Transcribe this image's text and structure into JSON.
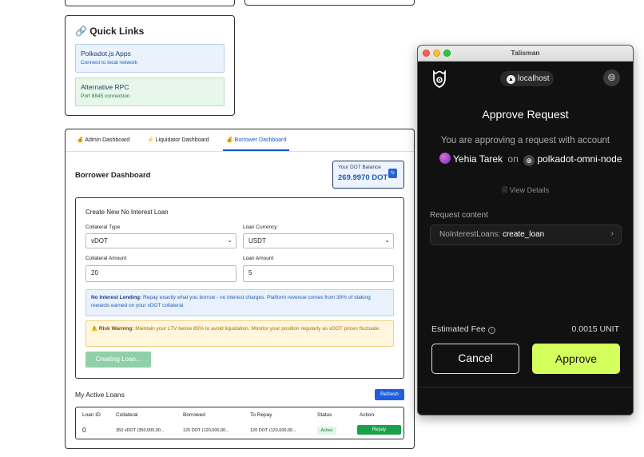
{
  "quick_links": {
    "title": "Quick Links",
    "items": [
      {
        "title": "Polkadot.js Apps",
        "subtitle": "Connect to local network"
      },
      {
        "title": "Alternative RPC",
        "subtitle": "Port 8845 connection"
      }
    ]
  },
  "tabs": [
    {
      "label": "Admin Dashboard"
    },
    {
      "label": "Liquidator Dashboard"
    },
    {
      "label": "Borrower Dashboard"
    }
  ],
  "borrower": {
    "title": "Borrower Dashboard",
    "balance_label": "Your DOT Balance",
    "balance_value": "269.9970 DOT",
    "form": {
      "title": "Create New No Interest Loan",
      "collateral_type_label": "Collateral Type",
      "collateral_type_value": "vDOT",
      "loan_currency_label": "Loan Currency",
      "loan_currency_value": "USDT",
      "collateral_amount_label": "Collateral Amount",
      "collateral_amount_value": "20",
      "loan_amount_label": "Loan Amount",
      "loan_amount_value": "5",
      "info_bold": "No Interest Lending:",
      "info_text": "Repay exactly what you borrow - no interest charges. Platform revenue comes from 30% of staking rewards earned on your vDOT collateral.",
      "warn_bold": "Risk Warning:",
      "warn_text": "Maintain your LTV below 85% to avoid liquidation. Monitor your position regularly as vDOT prices fluctuate.",
      "create_button": "Creating Loan..."
    },
    "loans": {
      "title": "My Active Loans",
      "refresh": "Refresh",
      "headers": [
        "Loan ID",
        "Collateral",
        "Borrowed",
        "To Repay",
        "Status",
        "Action"
      ],
      "rows": [
        {
          "id": "0",
          "collateral": "350 vDOT (350,000,00...",
          "borrowed": "120 DOT (120,000,00...",
          "to_repay": "120 DOT (120,000,00...",
          "status": "Active",
          "action": "Repay"
        }
      ]
    }
  },
  "talisman": {
    "window_title": "Talisman",
    "host": "localhost",
    "heading": "Approve Request",
    "approving_text": "You are approving a request with account",
    "account": "Yehia Tarek",
    "on": "on",
    "network": "polkadot-omni-node",
    "view_details": "View Details",
    "request_content_label": "Request content",
    "request_module": "NoInterestLoans:",
    "request_call": "create_loan",
    "fee_label": "Estimated Fee",
    "fee_value": "0.0015 UNIT",
    "cancel": "Cancel",
    "approve": "Approve"
  }
}
